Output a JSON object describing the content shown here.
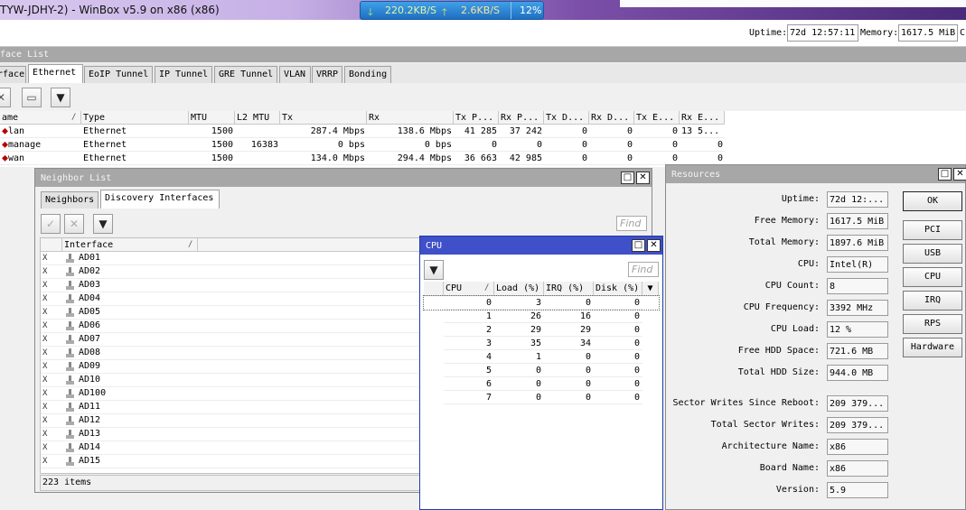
{
  "window": {
    "title": "TYW-JDHY-2) - WinBox v5.9 on x86 (x86)",
    "net_down": "220.2KB/S",
    "net_up": "2.6KB/S",
    "cpu_badge": "12%"
  },
  "status": {
    "uptime_label": "Uptime:",
    "uptime_value": "72d 12:57:11",
    "memory_label": "Memory:",
    "memory_value": "1617.5 MiB",
    "trailing": "C"
  },
  "interface_list": {
    "title": "face List",
    "tabs": [
      "rface",
      "Ethernet",
      "EoIP Tunnel",
      "IP Tunnel",
      "GRE Tunnel",
      "VLAN",
      "VRRP",
      "Bonding"
    ],
    "columns": [
      "ame",
      "Type",
      "MTU",
      "L2 MTU",
      "Tx",
      "Rx",
      "Tx P...",
      "Rx P...",
      "Tx D...",
      "Rx D...",
      "Tx E...",
      "Rx E..."
    ],
    "rows": [
      {
        "name": "lan",
        "type": "Ethernet",
        "mtu": "1500",
        "l2mtu": "",
        "tx": "287.4 Mbps",
        "rx": "138.6 Mbps",
        "txp": "41 285",
        "rxp": "37 242",
        "txd": "0",
        "rxd": "0",
        "txe": "0",
        "rxe": "13 5..."
      },
      {
        "name": "manage",
        "type": "Ethernet",
        "mtu": "1500",
        "l2mtu": "16383",
        "tx": "0 bps",
        "rx": "0 bps",
        "txp": "0",
        "rxp": "0",
        "txd": "0",
        "rxd": "0",
        "txe": "0",
        "rxe": "0"
      },
      {
        "name": "wan",
        "type": "Ethernet",
        "mtu": "1500",
        "l2mtu": "",
        "tx": "134.0 Mbps",
        "rx": "294.4 Mbps",
        "txp": "36 663",
        "rxp": "42 985",
        "txd": "0",
        "rxd": "0",
        "txe": "0",
        "rxe": "0"
      }
    ]
  },
  "neighbor_list": {
    "title": "Neighbor List",
    "tabs": [
      "Neighbors",
      "Discovery Interfaces"
    ],
    "find_placeholder": "Find",
    "column": "Interface",
    "rows": [
      {
        "flag": "X",
        "name": "AD01"
      },
      {
        "flag": "X",
        "name": "AD02"
      },
      {
        "flag": "X",
        "name": "AD03"
      },
      {
        "flag": "X",
        "name": "AD04"
      },
      {
        "flag": "X",
        "name": "AD05"
      },
      {
        "flag": "X",
        "name": "AD06"
      },
      {
        "flag": "X",
        "name": "AD07"
      },
      {
        "flag": "X",
        "name": "AD08"
      },
      {
        "flag": "X",
        "name": "AD09"
      },
      {
        "flag": "X",
        "name": "AD10"
      },
      {
        "flag": "X",
        "name": "AD100"
      },
      {
        "flag": "X",
        "name": "AD11"
      },
      {
        "flag": "X",
        "name": "AD12"
      },
      {
        "flag": "X",
        "name": "AD13"
      },
      {
        "flag": "X",
        "name": "AD14"
      },
      {
        "flag": "X",
        "name": "AD15"
      }
    ],
    "status": "223 items"
  },
  "cpu_window": {
    "title": "CPU",
    "find_placeholder": "Find",
    "columns": [
      "CPU",
      "Load (%)",
      "IRQ (%)",
      "Disk (%)"
    ],
    "rows": [
      {
        "cpu": "0",
        "load": "3",
        "irq": "0",
        "disk": "0"
      },
      {
        "cpu": "1",
        "load": "26",
        "irq": "16",
        "disk": "0"
      },
      {
        "cpu": "2",
        "load": "29",
        "irq": "29",
        "disk": "0"
      },
      {
        "cpu": "3",
        "load": "35",
        "irq": "34",
        "disk": "0"
      },
      {
        "cpu": "4",
        "load": "1",
        "irq": "0",
        "disk": "0"
      },
      {
        "cpu": "5",
        "load": "0",
        "irq": "0",
        "disk": "0"
      },
      {
        "cpu": "6",
        "load": "0",
        "irq": "0",
        "disk": "0"
      },
      {
        "cpu": "7",
        "load": "0",
        "irq": "0",
        "disk": "0"
      }
    ]
  },
  "resources": {
    "title": "Resources",
    "fields": [
      {
        "label": "Uptime:",
        "value": "72d 12:..."
      },
      {
        "label": "Free Memory:",
        "value": "1617.5 MiB"
      },
      {
        "label": "Total Memory:",
        "value": "1897.6 MiB"
      },
      {
        "label": "CPU:",
        "value": "Intel(R)"
      },
      {
        "label": "CPU Count:",
        "value": "8"
      },
      {
        "label": "CPU Frequency:",
        "value": "3392 MHz"
      },
      {
        "label": "CPU Load:",
        "value": "12 %"
      },
      {
        "label": "Free HDD Space:",
        "value": "721.6 MB"
      },
      {
        "label": "Total HDD Size:",
        "value": "944.0 MB"
      },
      {
        "label": "Sector Writes Since Reboot:",
        "value": "209 379..."
      },
      {
        "label": "Total Sector Writes:",
        "value": "209 379..."
      },
      {
        "label": "Architecture Name:",
        "value": "x86"
      },
      {
        "label": "Board Name:",
        "value": "x86"
      },
      {
        "label": "Version:",
        "value": "5.9"
      }
    ],
    "buttons": [
      "OK",
      "PCI",
      "USB",
      "CPU",
      "IRQ",
      "RPS",
      "Hardware"
    ]
  }
}
